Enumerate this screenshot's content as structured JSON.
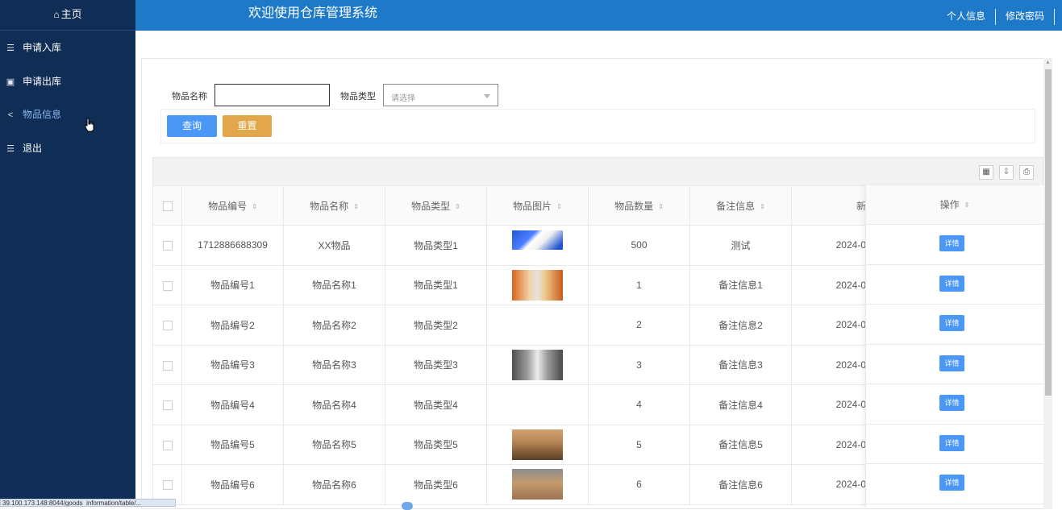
{
  "app": {
    "title": "欢迎使用仓库管理系统"
  },
  "header": {
    "profile_label": "个人信息",
    "password_label": "修改密码"
  },
  "sidebar": {
    "home_label": "主页",
    "items": [
      {
        "label": "申请入库",
        "icon": "list-indent-icon"
      },
      {
        "label": "申请出库",
        "icon": "save-icon"
      },
      {
        "label": "物品信息",
        "icon": "share-icon",
        "active": true
      },
      {
        "label": "退出",
        "icon": "list-indent-icon"
      }
    ]
  },
  "search": {
    "name_label": "物品名称",
    "name_value": "",
    "type_label": "物品类型",
    "type_placeholder": "请选择",
    "query_button": "查询",
    "reset_button": "重置"
  },
  "table": {
    "columns": [
      "物品编号",
      "物品名称",
      "物品类型",
      "物品图片",
      "物品数量",
      "备注信息",
      "新"
    ],
    "op_column": "操作",
    "detail_button": "详情",
    "rows": [
      {
        "code": "1712886688309",
        "name": "XX物品",
        "type": "物品类型1",
        "has_image": true,
        "qty": "500",
        "remark": "测试",
        "date": "2024-0"
      },
      {
        "code": "物品编号1",
        "name": "物品名称1",
        "type": "物品类型1",
        "has_image": true,
        "qty": "1",
        "remark": "备注信息1",
        "date": "2024-0"
      },
      {
        "code": "物品编号2",
        "name": "物品名称2",
        "type": "物品类型2",
        "has_image": false,
        "qty": "2",
        "remark": "备注信息2",
        "date": "2024-0"
      },
      {
        "code": "物品编号3",
        "name": "物品名称3",
        "type": "物品类型3",
        "has_image": true,
        "qty": "3",
        "remark": "备注信息3",
        "date": "2024-0"
      },
      {
        "code": "物品编号4",
        "name": "物品名称4",
        "type": "物品类型4",
        "has_image": false,
        "qty": "4",
        "remark": "备注信息4",
        "date": "2024-0"
      },
      {
        "code": "物品编号5",
        "name": "物品名称5",
        "type": "物品类型5",
        "has_image": true,
        "qty": "5",
        "remark": "备注信息5",
        "date": "2024-0"
      },
      {
        "code": "物品编号6",
        "name": "物品名称6",
        "type": "物品类型6",
        "has_image": true,
        "qty": "6",
        "remark": "备注信息6",
        "date": "2024-0"
      }
    ]
  },
  "statusbar": {
    "url": "39.100.173.148:8044/goods_information/table/..."
  },
  "colors": {
    "sidebar_bg": "#0f2d55",
    "header_bg": "#1e7ac9",
    "primary": "#4a97f5",
    "warning": "#e2a74a"
  }
}
